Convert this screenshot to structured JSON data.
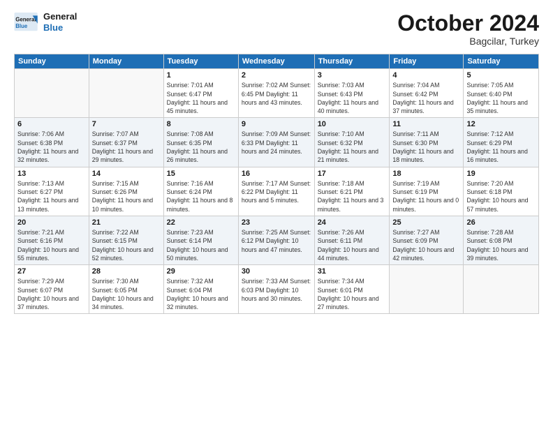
{
  "header": {
    "logo_line1": "General",
    "logo_line2": "Blue",
    "month": "October 2024",
    "location": "Bagcilar, Turkey"
  },
  "days_of_week": [
    "Sunday",
    "Monday",
    "Tuesday",
    "Wednesday",
    "Thursday",
    "Friday",
    "Saturday"
  ],
  "weeks": [
    [
      {
        "day": "",
        "info": ""
      },
      {
        "day": "",
        "info": ""
      },
      {
        "day": "1",
        "info": "Sunrise: 7:01 AM\nSunset: 6:47 PM\nDaylight: 11 hours and 45 minutes."
      },
      {
        "day": "2",
        "info": "Sunrise: 7:02 AM\nSunset: 6:45 PM\nDaylight: 11 hours and 43 minutes."
      },
      {
        "day": "3",
        "info": "Sunrise: 7:03 AM\nSunset: 6:43 PM\nDaylight: 11 hours and 40 minutes."
      },
      {
        "day": "4",
        "info": "Sunrise: 7:04 AM\nSunset: 6:42 PM\nDaylight: 11 hours and 37 minutes."
      },
      {
        "day": "5",
        "info": "Sunrise: 7:05 AM\nSunset: 6:40 PM\nDaylight: 11 hours and 35 minutes."
      }
    ],
    [
      {
        "day": "6",
        "info": "Sunrise: 7:06 AM\nSunset: 6:38 PM\nDaylight: 11 hours and 32 minutes."
      },
      {
        "day": "7",
        "info": "Sunrise: 7:07 AM\nSunset: 6:37 PM\nDaylight: 11 hours and 29 minutes."
      },
      {
        "day": "8",
        "info": "Sunrise: 7:08 AM\nSunset: 6:35 PM\nDaylight: 11 hours and 26 minutes."
      },
      {
        "day": "9",
        "info": "Sunrise: 7:09 AM\nSunset: 6:33 PM\nDaylight: 11 hours and 24 minutes."
      },
      {
        "day": "10",
        "info": "Sunrise: 7:10 AM\nSunset: 6:32 PM\nDaylight: 11 hours and 21 minutes."
      },
      {
        "day": "11",
        "info": "Sunrise: 7:11 AM\nSunset: 6:30 PM\nDaylight: 11 hours and 18 minutes."
      },
      {
        "day": "12",
        "info": "Sunrise: 7:12 AM\nSunset: 6:29 PM\nDaylight: 11 hours and 16 minutes."
      }
    ],
    [
      {
        "day": "13",
        "info": "Sunrise: 7:13 AM\nSunset: 6:27 PM\nDaylight: 11 hours and 13 minutes."
      },
      {
        "day": "14",
        "info": "Sunrise: 7:15 AM\nSunset: 6:26 PM\nDaylight: 11 hours and 10 minutes."
      },
      {
        "day": "15",
        "info": "Sunrise: 7:16 AM\nSunset: 6:24 PM\nDaylight: 11 hours and 8 minutes."
      },
      {
        "day": "16",
        "info": "Sunrise: 7:17 AM\nSunset: 6:22 PM\nDaylight: 11 hours and 5 minutes."
      },
      {
        "day": "17",
        "info": "Sunrise: 7:18 AM\nSunset: 6:21 PM\nDaylight: 11 hours and 3 minutes."
      },
      {
        "day": "18",
        "info": "Sunrise: 7:19 AM\nSunset: 6:19 PM\nDaylight: 11 hours and 0 minutes."
      },
      {
        "day": "19",
        "info": "Sunrise: 7:20 AM\nSunset: 6:18 PM\nDaylight: 10 hours and 57 minutes."
      }
    ],
    [
      {
        "day": "20",
        "info": "Sunrise: 7:21 AM\nSunset: 6:16 PM\nDaylight: 10 hours and 55 minutes."
      },
      {
        "day": "21",
        "info": "Sunrise: 7:22 AM\nSunset: 6:15 PM\nDaylight: 10 hours and 52 minutes."
      },
      {
        "day": "22",
        "info": "Sunrise: 7:23 AM\nSunset: 6:14 PM\nDaylight: 10 hours and 50 minutes."
      },
      {
        "day": "23",
        "info": "Sunrise: 7:25 AM\nSunset: 6:12 PM\nDaylight: 10 hours and 47 minutes."
      },
      {
        "day": "24",
        "info": "Sunrise: 7:26 AM\nSunset: 6:11 PM\nDaylight: 10 hours and 44 minutes."
      },
      {
        "day": "25",
        "info": "Sunrise: 7:27 AM\nSunset: 6:09 PM\nDaylight: 10 hours and 42 minutes."
      },
      {
        "day": "26",
        "info": "Sunrise: 7:28 AM\nSunset: 6:08 PM\nDaylight: 10 hours and 39 minutes."
      }
    ],
    [
      {
        "day": "27",
        "info": "Sunrise: 7:29 AM\nSunset: 6:07 PM\nDaylight: 10 hours and 37 minutes."
      },
      {
        "day": "28",
        "info": "Sunrise: 7:30 AM\nSunset: 6:05 PM\nDaylight: 10 hours and 34 minutes."
      },
      {
        "day": "29",
        "info": "Sunrise: 7:32 AM\nSunset: 6:04 PM\nDaylight: 10 hours and 32 minutes."
      },
      {
        "day": "30",
        "info": "Sunrise: 7:33 AM\nSunset: 6:03 PM\nDaylight: 10 hours and 30 minutes."
      },
      {
        "day": "31",
        "info": "Sunrise: 7:34 AM\nSunset: 6:01 PM\nDaylight: 10 hours and 27 minutes."
      },
      {
        "day": "",
        "info": ""
      },
      {
        "day": "",
        "info": ""
      }
    ]
  ]
}
